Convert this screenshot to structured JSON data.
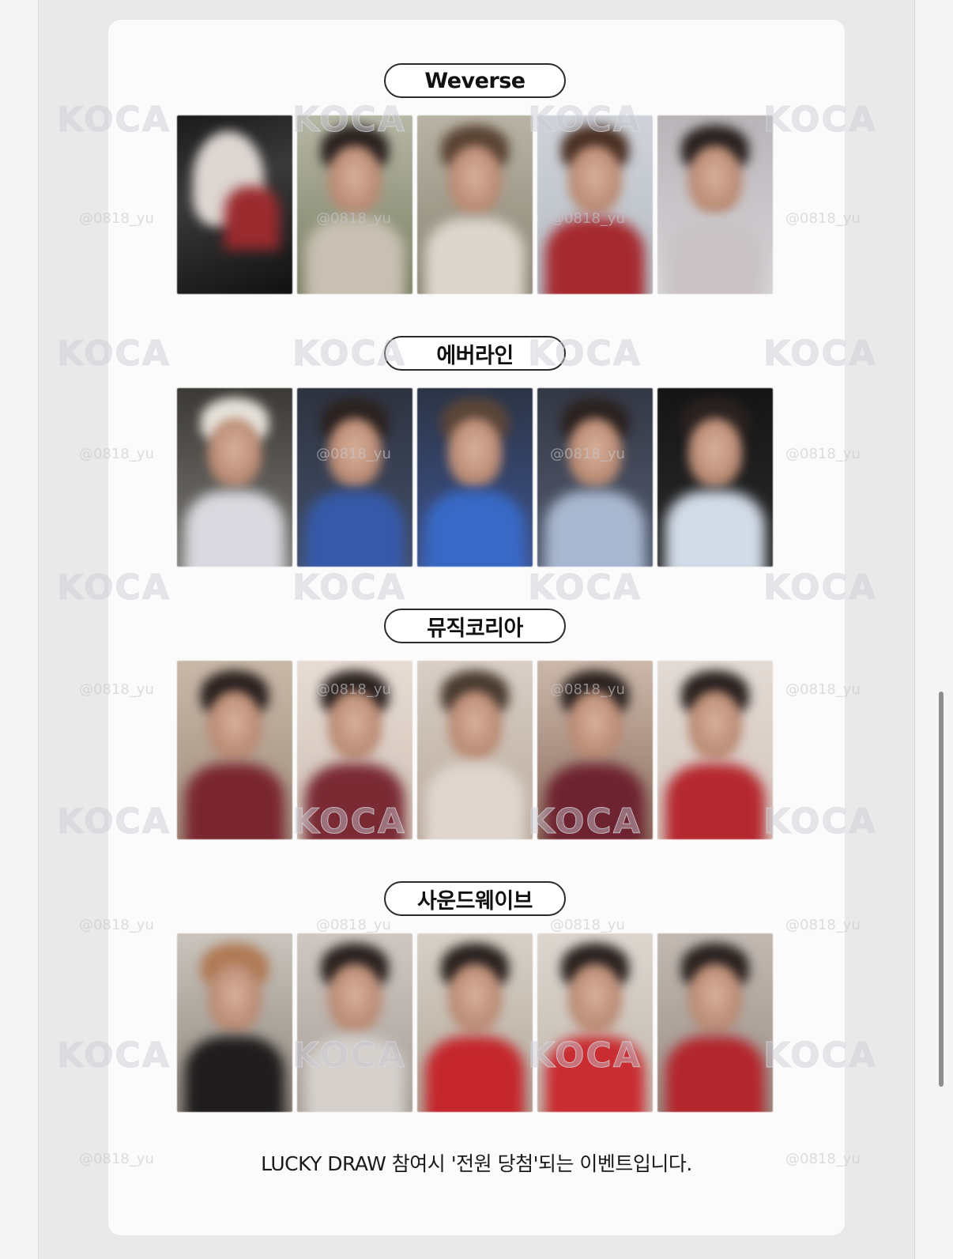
{
  "sections": [
    {
      "label": "Weverse",
      "cards": [
        "photocard-1",
        "photocard-2",
        "photocard-3",
        "photocard-4",
        "photocard-5"
      ]
    },
    {
      "label": "에버라인",
      "cards": [
        "photocard-1",
        "photocard-2",
        "photocard-3",
        "photocard-4",
        "photocard-5"
      ]
    },
    {
      "label": "뮤직코리아",
      "cards": [
        "photocard-1",
        "photocard-2",
        "photocard-3",
        "photocard-4",
        "photocard-5"
      ]
    },
    {
      "label": "사운드웨이브",
      "cards": [
        "photocard-1",
        "photocard-2",
        "photocard-3",
        "photocard-4",
        "photocard-5"
      ]
    }
  ],
  "watermarks": {
    "logo_text": "KOCA",
    "handle": "@0818_yu"
  },
  "footer": {
    "note": "LUCKY DRAW 참여시 '전원 당첨'되는 이벤트입니다."
  },
  "colors": {
    "card_bg": "#fbfbfb",
    "outer_bg": "#e9e9ea",
    "pill_border": "#2a2a2a"
  }
}
